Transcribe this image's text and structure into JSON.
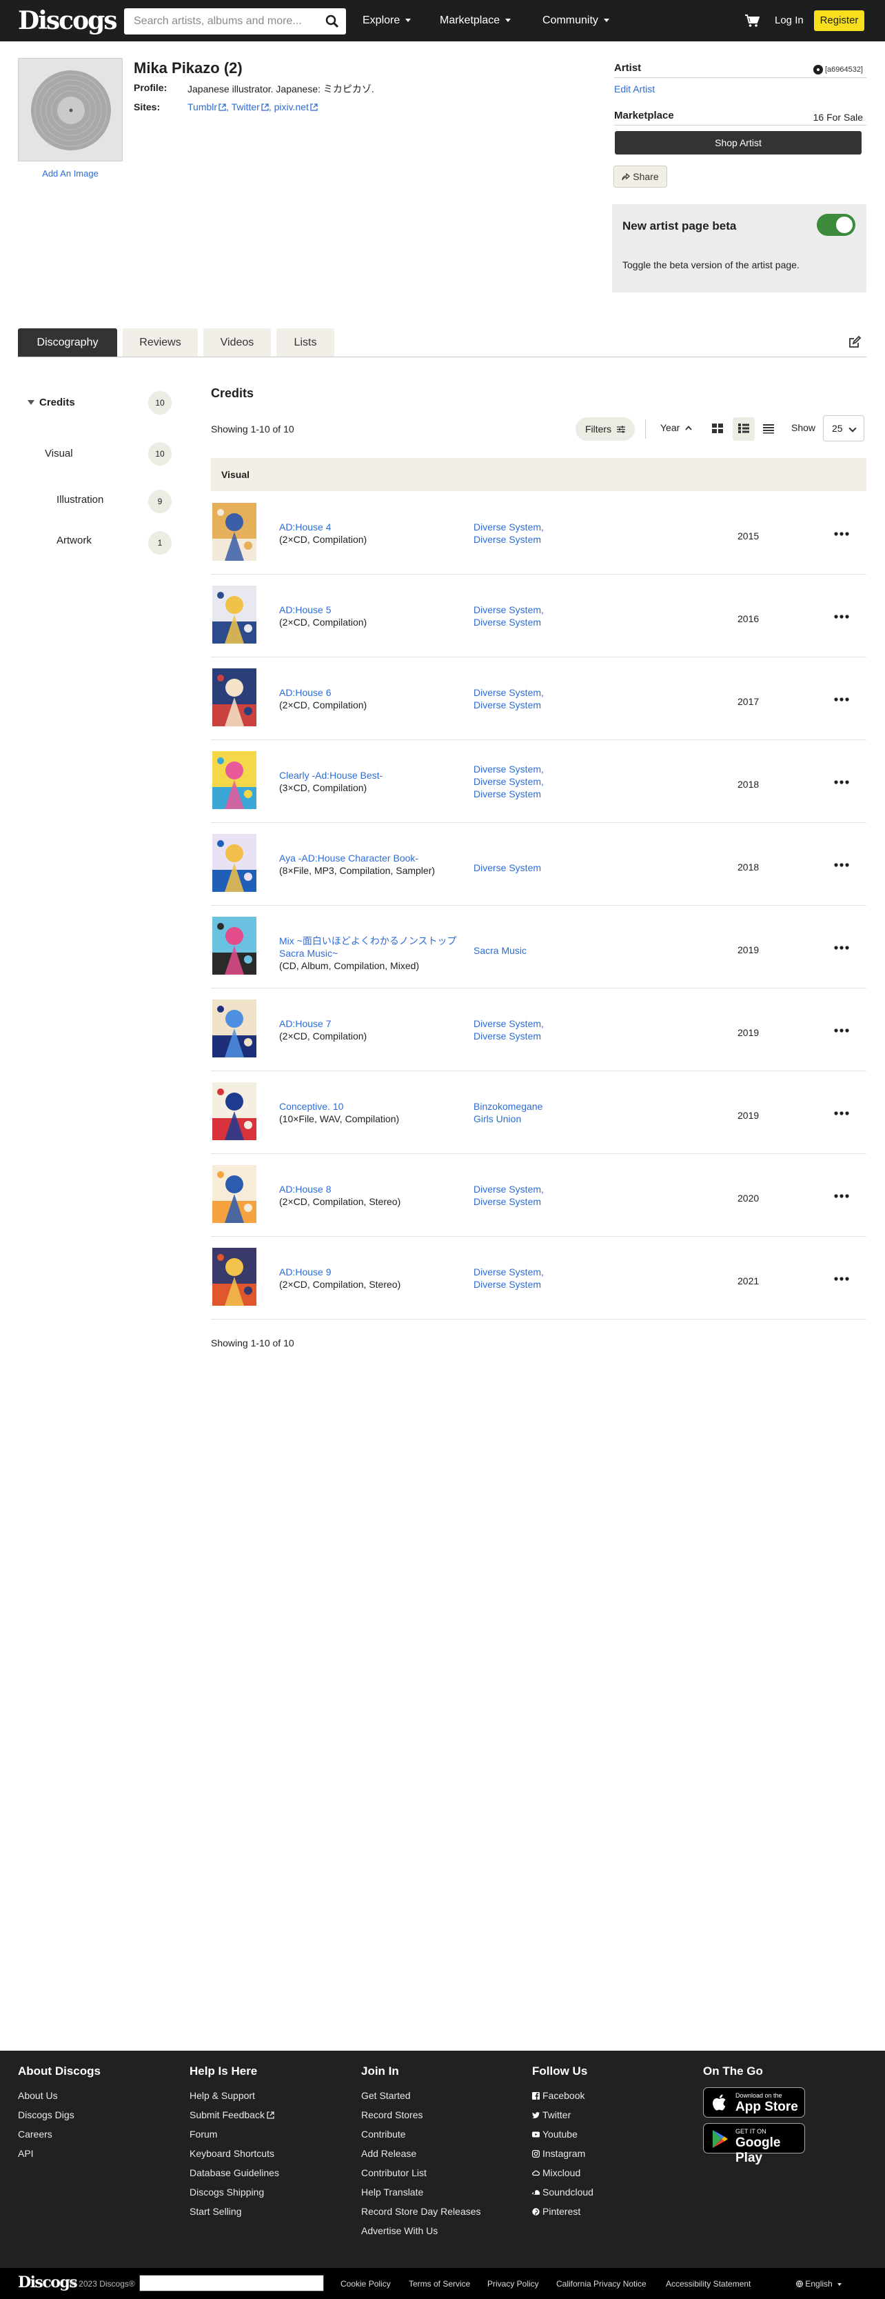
{
  "header": {
    "logo": "Discogs",
    "search_placeholder": "Search artists, albums and more...",
    "nav": [
      "Explore",
      "Marketplace",
      "Community"
    ],
    "login": "Log In",
    "register": "Register"
  },
  "artist": {
    "name": "Mika Pikazo (2)",
    "add_image": "Add An Image",
    "profile_label": "Profile:",
    "profile_value": "Japanese illustrator. Japanese: ミカピカゾ.",
    "sites_label": "Sites:",
    "sites": [
      "Tumblr",
      "Twitter",
      "pixiv.net"
    ]
  },
  "panel": {
    "artist_label": "Artist",
    "artist_id": "[a6964532]",
    "edit_artist": "Edit Artist",
    "marketplace_label": "Marketplace",
    "for_sale": "16 For Sale",
    "shop_artist": "Shop Artist",
    "share": "Share",
    "beta_title": "New artist page beta",
    "beta_desc": "Toggle the beta version of the artist page.",
    "beta_on": true
  },
  "tabs": [
    "Discography",
    "Reviews",
    "Videos",
    "Lists"
  ],
  "sidebar": {
    "credits": {
      "label": "Credits",
      "count": "10"
    },
    "visual": {
      "label": "Visual",
      "count": "10"
    },
    "illustration": {
      "label": "Illustration",
      "count": "9"
    },
    "artwork": {
      "label": "Artwork",
      "count": "1"
    }
  },
  "credits": {
    "title": "Credits",
    "showing": "Showing 1-10 of 10",
    "filters": "Filters",
    "sort": "Year",
    "show_label": "Show",
    "show_value": "25",
    "section": "Visual"
  },
  "releases": [
    {
      "title": "AD:House 4",
      "format": "(2×CD, Compilation)",
      "labels": [
        "Diverse System,",
        "Diverse System"
      ],
      "year": "2015",
      "colors": [
        "#f2e9d8",
        "#3a5fa8",
        "#e6b05a"
      ]
    },
    {
      "title": "AD:House 5",
      "format": "(2×CD, Compilation)",
      "labels": [
        "Diverse System,",
        "Diverse System"
      ],
      "year": "2016",
      "colors": [
        "#2c4a8c",
        "#f0c24a",
        "#e8e8f0"
      ]
    },
    {
      "title": "AD:House 6",
      "format": "(2×CD, Compilation)",
      "labels": [
        "Diverse System,",
        "Diverse System"
      ],
      "year": "2017",
      "colors": [
        "#c9423f",
        "#f4e3c8",
        "#2a3f7a"
      ]
    },
    {
      "title": "Clearly -Ad:House Best-",
      "format": "(3×CD, Compilation)",
      "labels": [
        "Diverse System,",
        "Diverse System,",
        "Diverse System"
      ],
      "year": "2018",
      "colors": [
        "#3aa7d6",
        "#e85a9a",
        "#f5d84a"
      ]
    },
    {
      "title": "Aya -AD:House Character Book-",
      "format": "(8×File, MP3, Compilation, Sampler)",
      "labels": [
        "Diverse System"
      ],
      "year": "2018",
      "colors": [
        "#1f5fb8",
        "#f2c04a",
        "#e9e2f4"
      ]
    },
    {
      "title": "Mix ~面白いほどよくわかるノンストップSacra Music~",
      "format": "(CD, Album, Compilation, Mixed)",
      "labels": [
        "Sacra Music"
      ],
      "year": "2019",
      "colors": [
        "#2a2a2a",
        "#e34b8a",
        "#6ac2e0"
      ]
    },
    {
      "title": "AD:House 7",
      "format": "(2×CD, Compilation)",
      "labels": [
        "Diverse System,",
        "Diverse System"
      ],
      "year": "2019",
      "colors": [
        "#1c2f78",
        "#4f8fe0",
        "#f0e2c8"
      ]
    },
    {
      "title": "Conceptive. 10",
      "format": "(10×File, WAV, Compilation)",
      "labels": [
        "Binzokomegane",
        "Girls Union"
      ],
      "year": "2019",
      "colors": [
        "#d8323c",
        "#1d3c8f",
        "#f5efe2"
      ]
    },
    {
      "title": "AD:House 8",
      "format": "(2×CD, Compilation, Stereo)",
      "labels": [
        "Diverse System,",
        "Diverse System"
      ],
      "year": "2020",
      "colors": [
        "#f4a340",
        "#2b5cb0",
        "#f7ecd8"
      ]
    },
    {
      "title": "AD:House 9",
      "format": "(2×CD, Compilation, Stereo)",
      "labels": [
        "Diverse System,",
        "Diverse System"
      ],
      "year": "2021",
      "colors": [
        "#e0562e",
        "#f2c24c",
        "#3a3a6a"
      ]
    }
  ],
  "footer": {
    "columns": [
      {
        "title": "About Discogs",
        "links": [
          "About Us",
          "Discogs Digs",
          "Careers",
          "API"
        ]
      },
      {
        "title": "Help Is Here",
        "links": [
          "Help & Support",
          "Submit Feedback",
          "Forum",
          "Keyboard Shortcuts",
          "Database Guidelines",
          "Discogs Shipping",
          "Start Selling"
        ]
      },
      {
        "title": "Join In",
        "links": [
          "Get Started",
          "Record Stores",
          "Contribute",
          "Add Release",
          "Contributor List",
          "Help Translate",
          "Record Store Day Releases",
          "Advertise With Us"
        ]
      },
      {
        "title": "Follow Us",
        "links": [
          "Facebook",
          "Twitter",
          "Youtube",
          "Instagram",
          "Mixcloud",
          "Soundcloud",
          "Pinterest"
        ]
      },
      {
        "title": "On The Go",
        "links": []
      }
    ],
    "app_store": {
      "small": "Download on the",
      "big": "App Store"
    },
    "google_play": {
      "small": "GET IT ON",
      "big": "Google Play"
    },
    "copyright": "© 2023 Discogs®",
    "bottom_links": [
      "Cookie Policy",
      "Terms of Service",
      "Privacy Policy",
      "California Privacy Notice",
      "Accessibility Statement"
    ],
    "language": "English"
  }
}
